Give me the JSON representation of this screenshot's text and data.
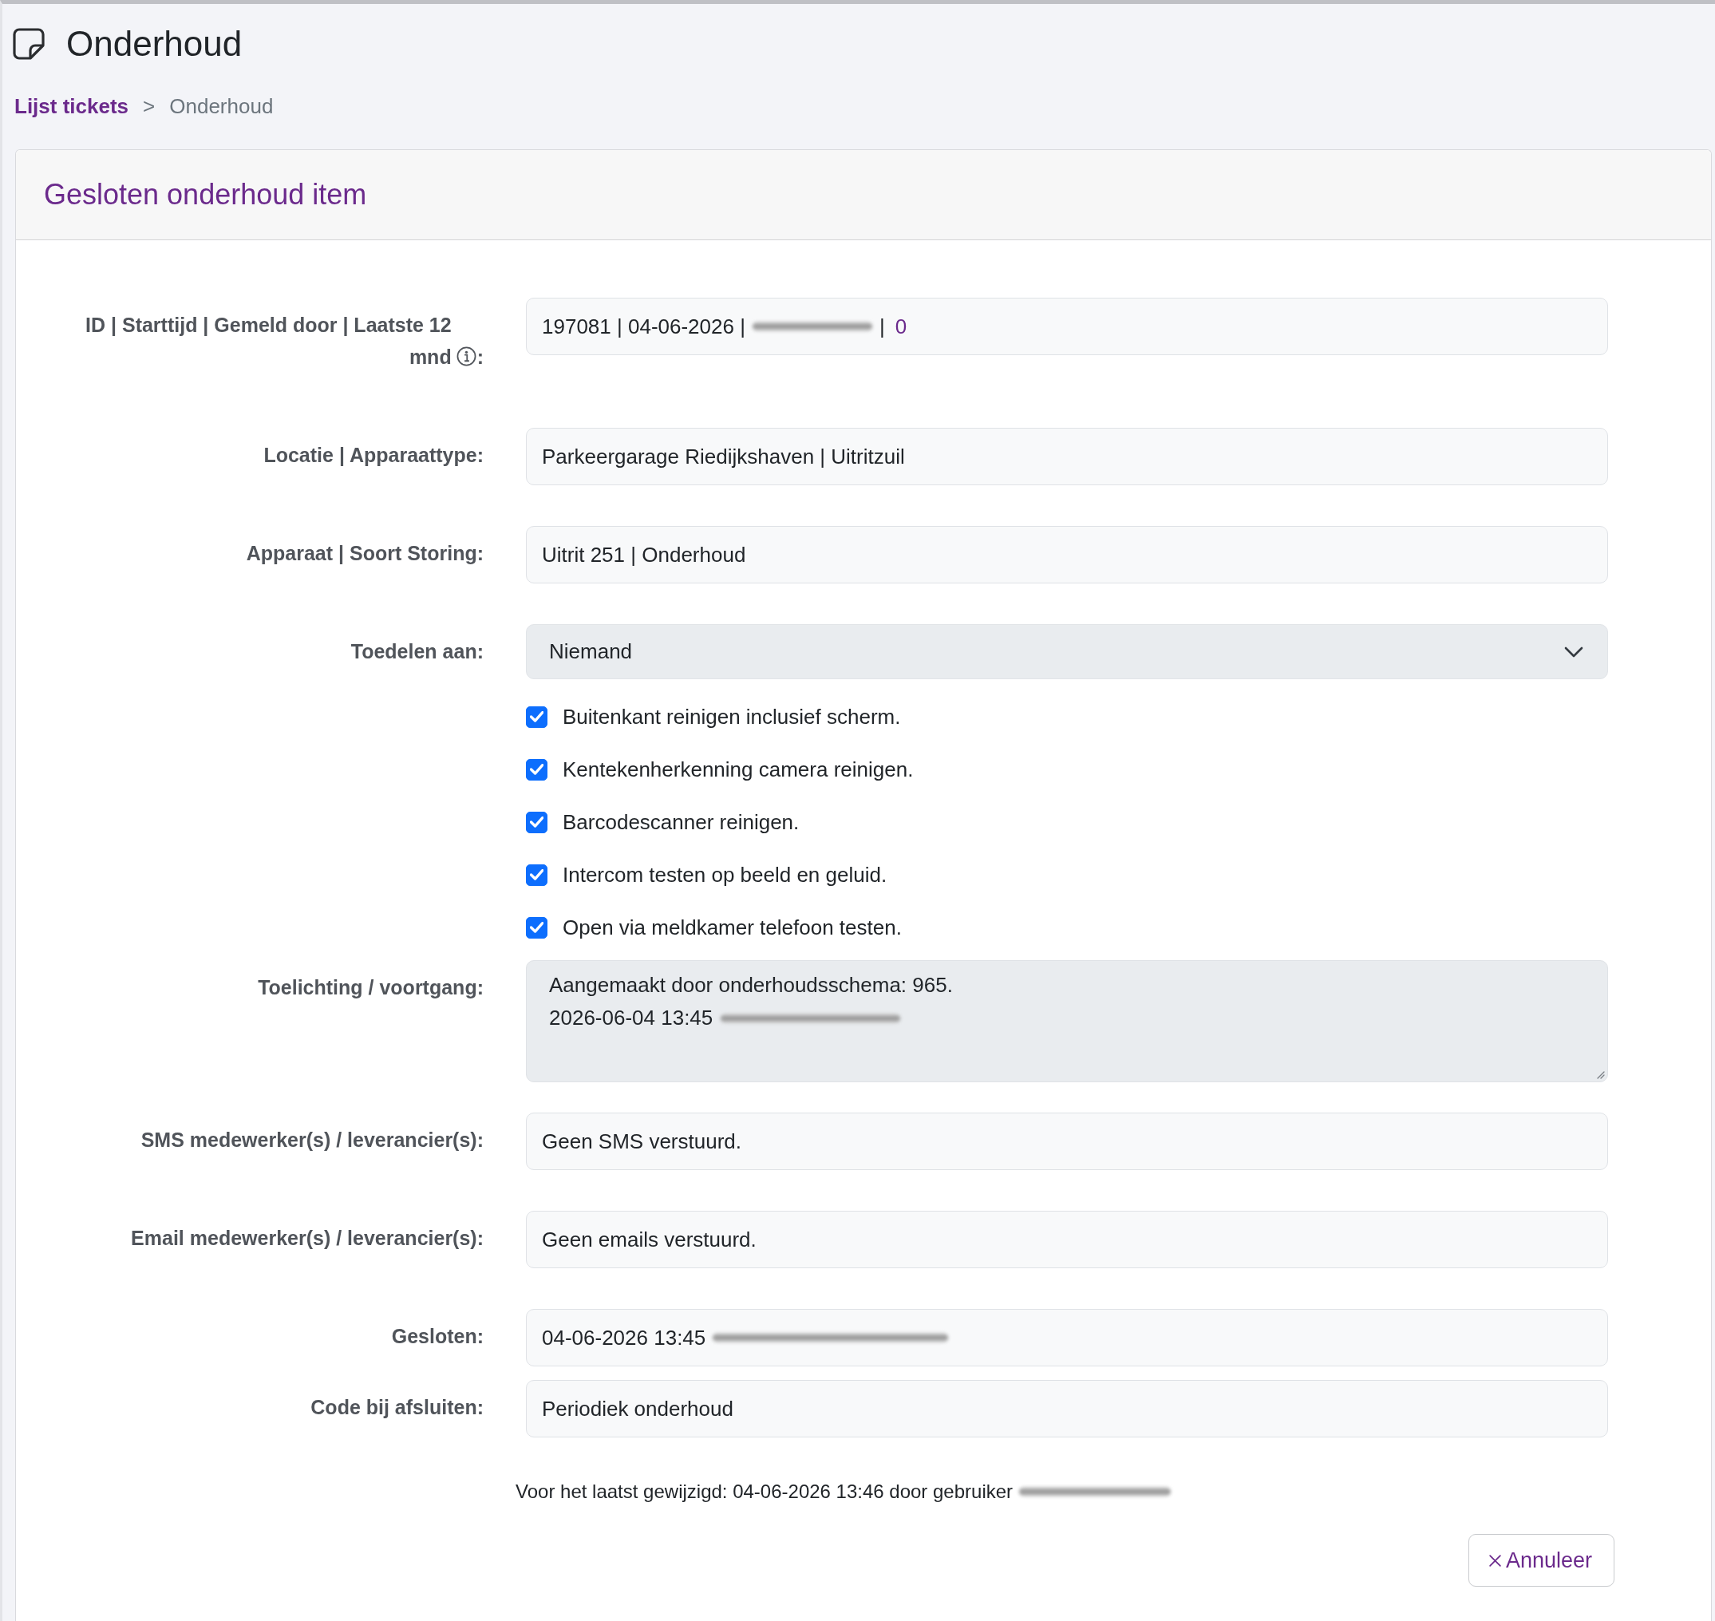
{
  "page": {
    "title": "Onderhoud"
  },
  "breadcrumb": [
    {
      "kind": "link",
      "label": "Lijst tickets"
    },
    {
      "kind": "separator",
      "label": ">"
    },
    {
      "kind": "current",
      "label": "Onderhoud"
    }
  ],
  "card": {
    "title": "Gesloten onderhoud item"
  },
  "fields": [
    {
      "kind": "input",
      "label": "ID | Starttijd | Gemeld door | Laatste 12 mnd",
      "info": true,
      "label_suffix": ":",
      "parts": [
        {
          "kind": "text",
          "text": "197081 | 04-06-2026 |"
        },
        {
          "kind": "redacted"
        },
        {
          "kind": "text",
          "text": "|"
        },
        {
          "kind": "link",
          "text": "0"
        }
      ]
    },
    {
      "kind": "input",
      "label": "Locatie | Apparaattype:",
      "parts": [
        {
          "kind": "text",
          "text": "Parkeergarage Riedijkshaven | Uitritzuil"
        }
      ]
    },
    {
      "kind": "input",
      "label": "Apparaat | Soort Storing:",
      "parts": [
        {
          "kind": "text",
          "text": "Uitrit 251 | Onderhoud"
        }
      ]
    },
    {
      "kind": "select",
      "label": "Toedelen aan:",
      "value": "Niemand"
    },
    {
      "kind": "checklist",
      "items": [
        {
          "label": "Buitenkant reinigen inclusief scherm.",
          "checked": true
        },
        {
          "label": "Kentekenherkenning camera reinigen.",
          "checked": true
        },
        {
          "label": "Barcodescanner reinigen.",
          "checked": true
        },
        {
          "label": "Intercom testen op beeld en geluid.",
          "checked": true
        },
        {
          "label": "Open via meldkamer telefoon testen.",
          "checked": true
        }
      ]
    },
    {
      "kind": "textarea",
      "label": "Toelichting / voortgang:",
      "lines": [
        [
          {
            "kind": "text",
            "text": "Aangemaakt door onderhoudsschema: 965."
          }
        ],
        [
          {
            "kind": "text",
            "text": "2026-06-04 13:45"
          },
          {
            "kind": "redacted"
          }
        ]
      ]
    },
    {
      "kind": "input",
      "label": "SMS medewerker(s) / leverancier(s):",
      "parts": [
        {
          "kind": "text",
          "text": "Geen SMS verstuurd."
        }
      ]
    },
    {
      "kind": "input",
      "label": "Email medewerker(s) / leverancier(s):",
      "parts": [
        {
          "kind": "text",
          "text": "Geen emails verstuurd."
        }
      ]
    },
    {
      "kind": "input",
      "label": "Gesloten:",
      "parts": [
        {
          "kind": "text",
          "text": "04-06-2026 13:45"
        },
        {
          "kind": "redacted"
        }
      ]
    },
    {
      "kind": "input",
      "label": "Code bij afsluiten:",
      "parts": [
        {
          "kind": "text",
          "text": "Periodiek onderhoud"
        }
      ]
    }
  ],
  "footer": {
    "parts": [
      {
        "kind": "text",
        "text": "Voor het laatst gewijzigd: 04-06-2026 13:46 door gebruiker"
      },
      {
        "kind": "redacted"
      }
    ]
  },
  "buttons": [
    {
      "label": "Annuleer"
    }
  ]
}
